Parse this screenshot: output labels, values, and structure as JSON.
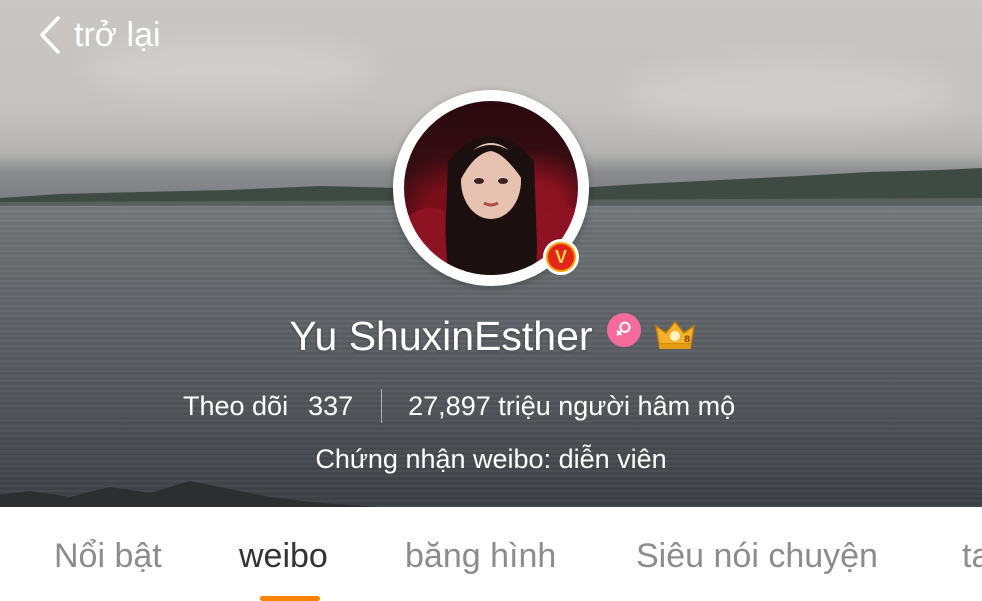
{
  "header": {
    "back_label": "trở lại"
  },
  "profile": {
    "name": "Yu ShuxinEsther",
    "following_label": "Theo dõi",
    "following_count": "337",
    "fans_text": "27,897 triệu người hâm mộ",
    "verification": "Chứng nhận weibo: diễn viên",
    "verified_badge": "V"
  },
  "tabs": [
    {
      "label": "Nổi bật",
      "active": false
    },
    {
      "label": "weibo",
      "active": true
    },
    {
      "label": "băng hình",
      "active": false
    },
    {
      "label": "Siêu nói chuyện",
      "active": false
    },
    {
      "label": "ta",
      "active": false
    }
  ],
  "colors": {
    "accent": "#ff8200",
    "female_badge": "#f56c9a",
    "verified": "#f7a000"
  }
}
